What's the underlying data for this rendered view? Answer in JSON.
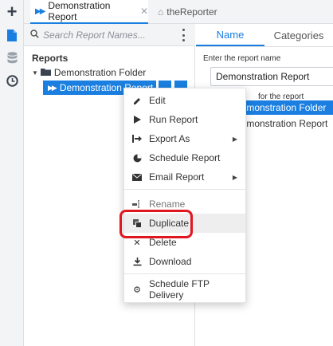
{
  "rail": {
    "icons": [
      "plus-icon",
      "document-icon",
      "database-icon",
      "clock-icon"
    ]
  },
  "tabs": {
    "active": {
      "label": "Demonstration Report",
      "icon": "report-icon"
    },
    "inactive": {
      "label": "theReporter",
      "icon": "home-icon"
    }
  },
  "left_panel": {
    "search_placeholder": "Search Report Names...",
    "tree_title": "Reports",
    "folder_label": "Demonstration Folder",
    "report_label": "Demonstration Report"
  },
  "right_panel": {
    "tabs": [
      "Name",
      "Categories"
    ],
    "name_field_label": "Enter the report name",
    "name_value": "Demonstration Report",
    "folder_field_label": "for the report",
    "folder_options": [
      "Demonstration Folder",
      "Demonstration Report"
    ]
  },
  "context_menu": {
    "items": [
      {
        "label": "Edit",
        "icon": "pencil-icon",
        "submenu": false
      },
      {
        "label": "Run Report",
        "icon": "play-icon",
        "submenu": false
      },
      {
        "label": "Export As",
        "icon": "export-icon",
        "submenu": true
      },
      {
        "label": "Schedule Report",
        "icon": "pie-icon",
        "submenu": false
      },
      {
        "label": "Email Report",
        "icon": "envelope-icon",
        "submenu": true
      },
      {
        "label": "Rename",
        "icon": "rename-icon",
        "submenu": false
      },
      {
        "label": "Duplicate",
        "icon": "duplicate-icon",
        "submenu": false
      },
      {
        "label": "Delete",
        "icon": "close-icon",
        "submenu": false
      },
      {
        "label": "Download",
        "icon": "download-icon",
        "submenu": false
      },
      {
        "label": "Schedule FTP Delivery",
        "icon": "gear-icon",
        "submenu": false
      }
    ],
    "highlighted": "Duplicate"
  },
  "colors": {
    "accent": "#1a7fe0",
    "highlight_ring": "#e0171e",
    "rail_bg": "#f3f4f6"
  }
}
